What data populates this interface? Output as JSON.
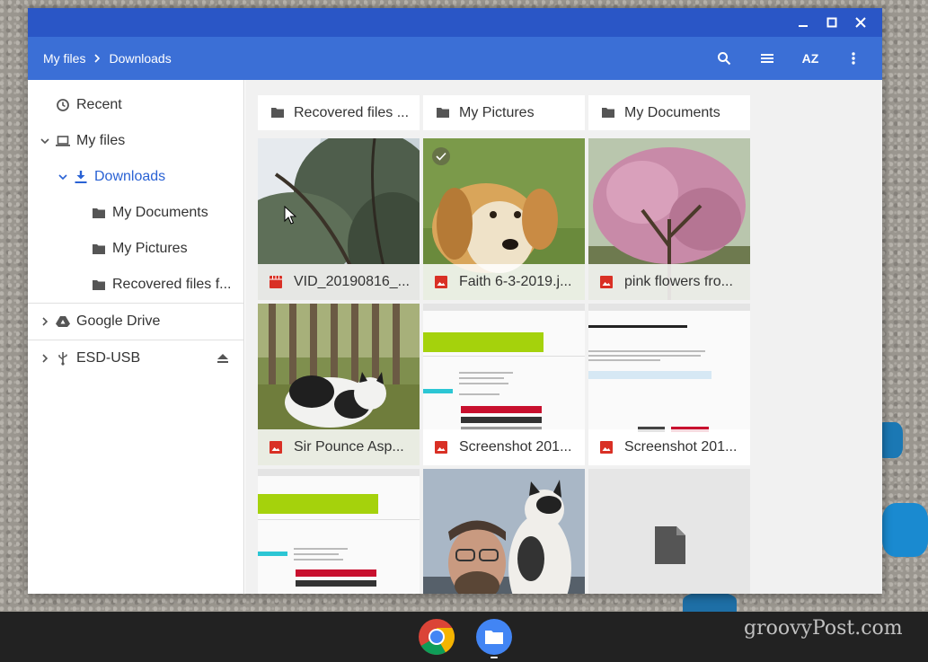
{
  "breadcrumb": {
    "root": "My files",
    "current": "Downloads"
  },
  "toolbar": {
    "sort_label": "AZ"
  },
  "sidebar": {
    "items": [
      {
        "label": "Recent",
        "icon": "clock-icon"
      },
      {
        "label": "My files",
        "icon": "laptop-icon"
      },
      {
        "label": "Downloads",
        "icon": "download-icon"
      },
      {
        "label": "My Documents",
        "icon": "folder-icon"
      },
      {
        "label": "My Pictures",
        "icon": "folder-icon"
      },
      {
        "label": "Recovered files f...",
        "icon": "folder-icon"
      },
      {
        "label": "Google Drive",
        "icon": "drive-icon"
      },
      {
        "label": "ESD-USB",
        "icon": "usb-icon"
      }
    ]
  },
  "folders": [
    {
      "label": "Recovered files ..."
    },
    {
      "label": "My Pictures"
    },
    {
      "label": "My Documents"
    }
  ],
  "files": [
    {
      "label": "VID_20190816_...",
      "icon": "video-file-icon"
    },
    {
      "label": "Faith 6-3-2019.j...",
      "icon": "image-file-icon"
    },
    {
      "label": "pink flowers fro...",
      "icon": "image-file-icon"
    },
    {
      "label": "Sir Pounce Asp...",
      "icon": "image-file-icon"
    },
    {
      "label": "Screenshot 201...",
      "icon": "image-file-icon"
    },
    {
      "label": "Screenshot 201...",
      "icon": "image-file-icon"
    }
  ],
  "screenshot_thumb_text": {
    "payment_title": "Payment Method",
    "balance": "Due by 06/15",
    "button": "GO TO BANK"
  },
  "watermark": "groovyPost.com",
  "colors": {
    "titlebar": "#2a56c6",
    "toolbar": "#3b6fd6",
    "accent": "#2a62d4",
    "file_icon": "#d93025"
  }
}
